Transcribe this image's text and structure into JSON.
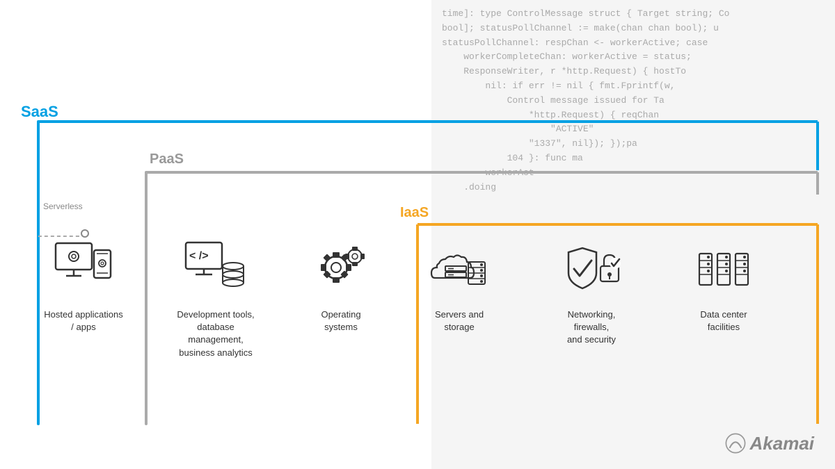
{
  "code_lines": [
    "time]: type ControlMessage struct { Target string; Co",
    "bool]; statusPollChannel := make(chan chan bool); u",
    "statusPollChannel: respChan <- workerActive; case",
    "    workerCompleteChan: workerActive = status;",
    "    ResponseWriter, r *http.Request) { hostTo",
    "        nil: if err != nil { fmt.Fprintf(w,",
    "            Control message issued for Ta",
    "                *http.Request) { reqChan",
    "                    \"ACTIVE\"",
    "                \"1337\", nil}); });pa",
    "            104 }: func ma",
    "        workerAct",
    "    .doing"
  ],
  "labels": {
    "saas": "SaaS",
    "paas": "PaaS",
    "iaas": "IaaS",
    "serverless": "Serverless"
  },
  "icons": [
    {
      "id": "hosted-apps",
      "label": "Hosted applications\n/ apps",
      "label_html": "Hosted applications<br>/ apps"
    },
    {
      "id": "dev-tools",
      "label": "Development tools, database management, business analytics",
      "label_html": "Development tools,<br>database<br>management,<br>business analytics"
    },
    {
      "id": "os",
      "label": "Operating systems",
      "label_html": "Operating<br>systems"
    },
    {
      "id": "servers",
      "label": "Servers and storage",
      "label_html": "Servers and<br>storage"
    },
    {
      "id": "networking",
      "label": "Networking, firewalls, and security",
      "label_html": "Networking,<br>firewalls,<br>and security"
    },
    {
      "id": "datacenter",
      "label": "Data center facilities",
      "label_html": "Data center<br>facilities"
    }
  ],
  "akamai": {
    "text": "Akamai"
  },
  "colors": {
    "saas": "#00a0e3",
    "paas": "#999999",
    "iaas": "#f5a623",
    "text": "#333333",
    "code_bg": "#f5f5f5"
  }
}
